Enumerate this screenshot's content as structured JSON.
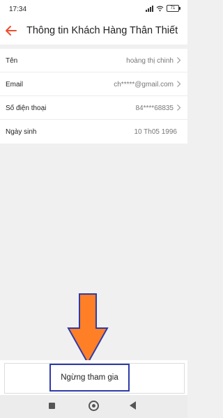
{
  "status_bar": {
    "time": "17:34",
    "battery": "71",
    "icons": [
      "signal-icon",
      "wifi-icon",
      "battery-icon"
    ]
  },
  "header": {
    "title": "Thông tin Khách Hàng Thân Thiết",
    "back_icon": "back-arrow-icon",
    "accent_color": "#ee4d2d"
  },
  "info": {
    "rows": [
      {
        "label": "Tên",
        "value": "hoàng thị chinh"
      },
      {
        "label": "Email",
        "value": "ch*****@gmail.com"
      },
      {
        "label": "Số điện thoại",
        "value": "84****68835"
      },
      {
        "label": "Ngày sinh",
        "value": "10 Th05 1996"
      }
    ]
  },
  "actions": {
    "stop_label": "Ngừng tham gia",
    "highlight_color": "#2f3aa8",
    "arrow_color": "#ff7f27"
  },
  "nav": {
    "icons": [
      "recent-apps-icon",
      "home-icon",
      "back-icon"
    ]
  }
}
